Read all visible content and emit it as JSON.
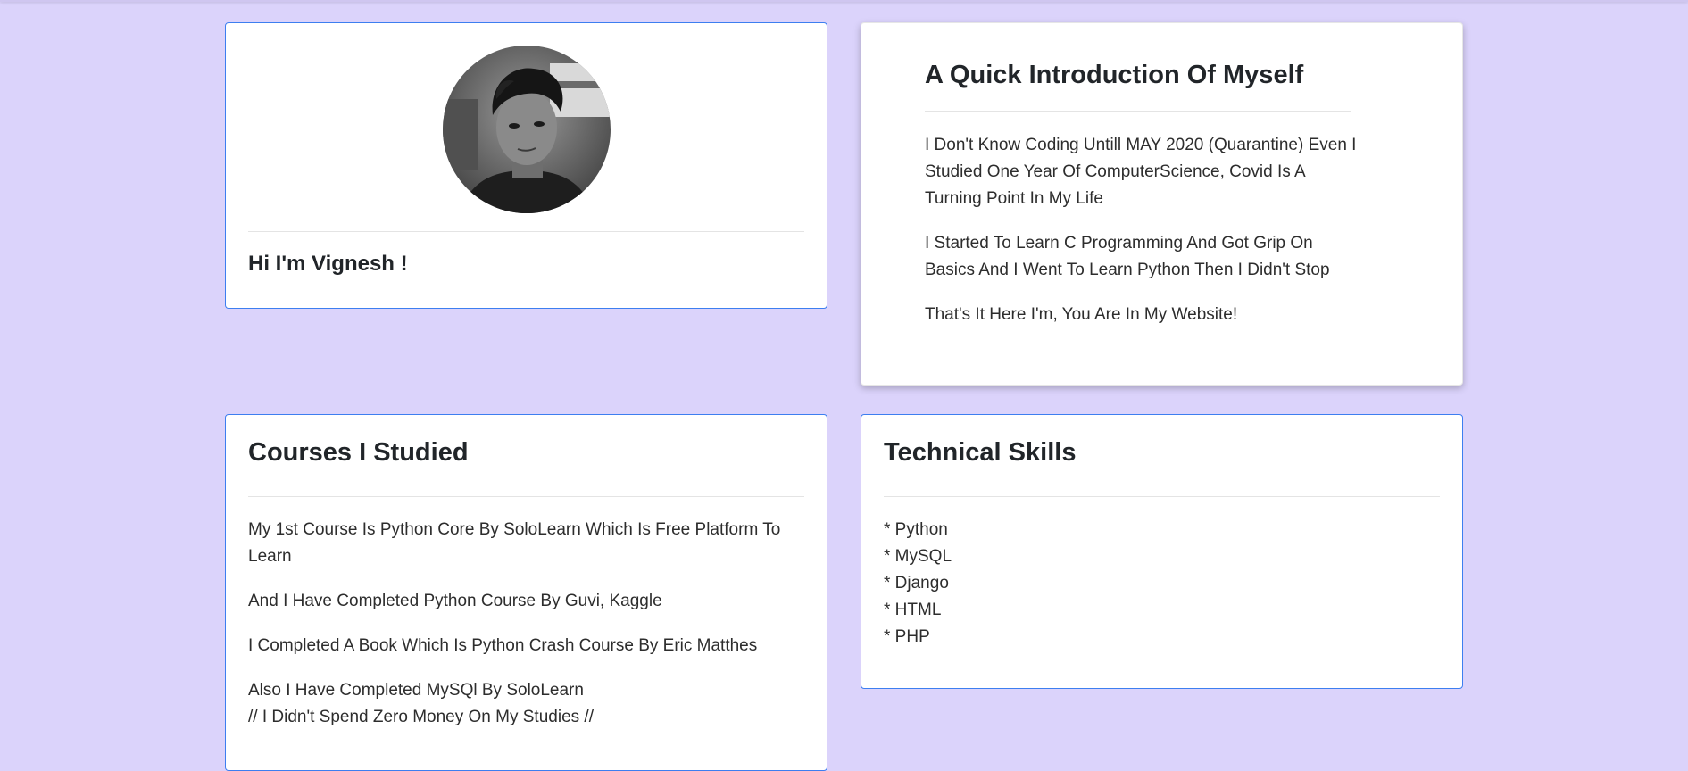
{
  "profile": {
    "photo_alt": "profile photo",
    "greeting": "Hi I'm Vignesh !"
  },
  "intro": {
    "title": "A Quick Introduction Of Myself",
    "paragraphs": [
      "I Don't Know Coding Untill MAY 2020 (Quarantine) Even I Studied One Year Of ComputerScience, Covid Is A Turning Point In My Life",
      "I Started To Learn C Programming And Got Grip On Basics And I Went To Learn Python Then I Didn't Stop",
      "That's It Here I'm, You Are In My Website!"
    ]
  },
  "courses": {
    "title": "Courses I Studied",
    "paragraphs": [
      "My 1st Course Is Python Core By SoloLearn Which Is Free Platform To Learn",
      "And I Have Completed Python Course By Guvi, Kaggle",
      "I Completed A Book Which Is Python Crash Course By Eric Matthes",
      "Also I Have Completed MySQl By SoloLearn",
      "// I Didn't Spend Zero Money On My Studies //"
    ]
  },
  "skills": {
    "title": "Technical Skills",
    "items": [
      "* Python",
      "* MySQL",
      "* Django",
      "* HTML",
      "* PHP"
    ]
  },
  "colors": {
    "background": "#dbd3fb",
    "card_border": "#3d7ef0"
  }
}
